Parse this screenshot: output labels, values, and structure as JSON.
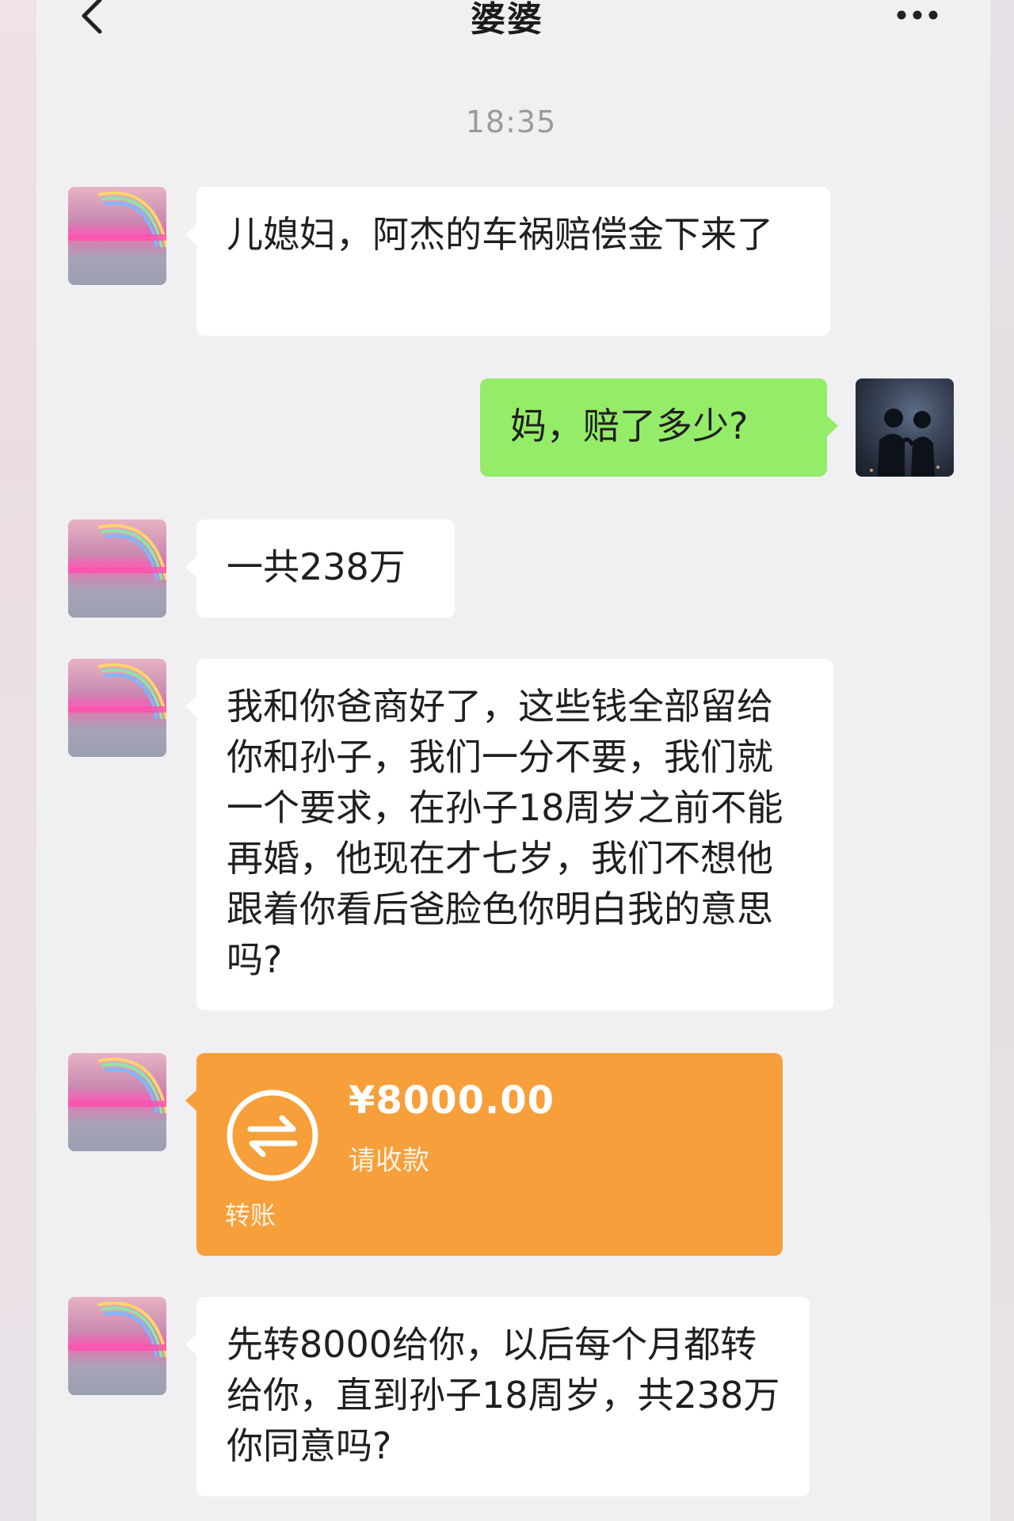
{
  "header": {
    "back_icon": "chevron-left-icon",
    "title": "婆婆",
    "more_icon": "more-dots-icon"
  },
  "timestamp": "18:35",
  "messages": [
    {
      "sender": "婆婆",
      "side": "left",
      "type": "text",
      "text": "儿媳妇，阿杰的车祸赔偿金下来了"
    },
    {
      "sender": "me",
      "side": "right",
      "type": "text",
      "text": "妈，赔了多少?"
    },
    {
      "sender": "婆婆",
      "side": "left",
      "type": "text",
      "text": "一共238万"
    },
    {
      "sender": "婆婆",
      "side": "left",
      "type": "text",
      "text": "我和你爸商好了，这些钱全部留给你和孙子，我们一分不要，我们就一个要求，在孙子18周岁之前不能再婚，他现在才七岁，我们不想他跟着你看后爸脸色你明白我的意思吗?"
    },
    {
      "sender": "婆婆",
      "side": "left",
      "type": "transfer",
      "amount": "¥8000.00",
      "status": "请收款",
      "label": "转账",
      "icon": "transfer-arrows-icon"
    },
    {
      "sender": "婆婆",
      "side": "left",
      "type": "text",
      "text": "先转8000给你，以后每个月都转给你，直到孙子18周岁，共238万你同意吗?"
    }
  ],
  "colors": {
    "background": "#f0f0f2",
    "bubble_incoming": "#ffffff",
    "bubble_outgoing": "#95ec69",
    "transfer_card": "#f79f3b"
  }
}
